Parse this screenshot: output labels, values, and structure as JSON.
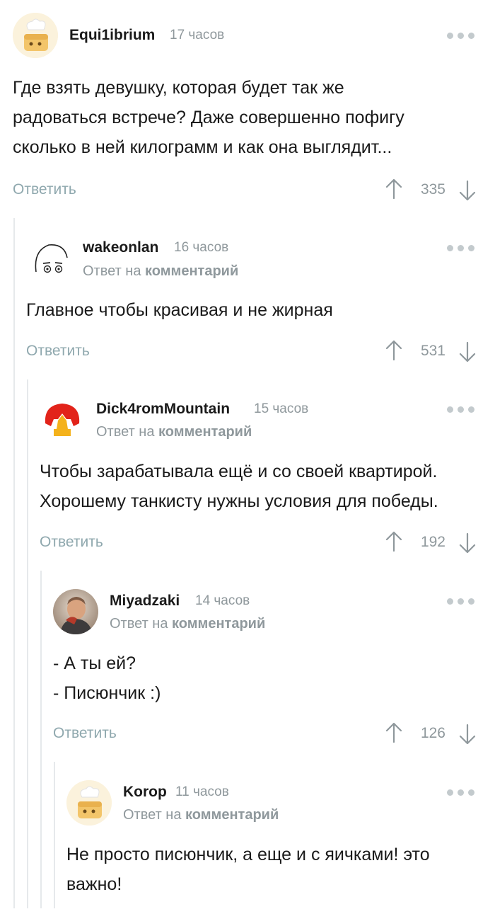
{
  "comments": [
    {
      "author": "Equi1ibrium",
      "time": "17 часов",
      "avatar_icon": "chef-toast-avatar-icon",
      "body": [
        "Где взять девушку, которая будет так же",
        "радоваться встрече? Даже совершенно пофигу",
        "сколько в ней килограмм и как она выглядит..."
      ],
      "reply_label": "Ответить",
      "rating": "335"
    },
    {
      "author": "wakeonlan",
      "time": "16 часов",
      "avatar_icon": "sketch-face-avatar-icon",
      "reply_to_prefix": "Ответ на",
      "reply_to_link": "комментарий",
      "body": [
        "Главное чтобы красивая и не жирная"
      ],
      "reply_label": "Ответить",
      "rating": "531"
    },
    {
      "author": "Dick4romMountain",
      "time": "15 часов",
      "avatar_icon": "red-yellow-logo-avatar-icon",
      "reply_to_prefix": "Ответ на",
      "reply_to_link": "комментарий",
      "body": [
        "Чтобы зарабатывала ещё и со своей квартирой.",
        "Хорошему танкисту нужны условия для победы."
      ],
      "reply_label": "Ответить",
      "rating": "192"
    },
    {
      "author": "Miyadzaki",
      "time": "14 часов",
      "avatar_icon": "photo-avatar-icon",
      "reply_to_prefix": "Ответ на",
      "reply_to_link": "комментарий",
      "body": [
        "- А ты ей?",
        "- Писюнчик :)"
      ],
      "reply_label": "Ответить",
      "rating": "126"
    },
    {
      "author": "Korop",
      "time": "11 часов",
      "avatar_icon": "chef-toast-avatar-icon",
      "reply_to_prefix": "Ответ на",
      "reply_to_link": "комментарий",
      "body": [
        "Не просто писюнчик, а еще и с яичками! это",
        "важно!"
      ]
    }
  ],
  "colors": {
    "muted_text": "#8f989c",
    "reply_link": "#8fa8ae",
    "thread_line": "#e6e9eb",
    "dots": "#c3cacd"
  }
}
